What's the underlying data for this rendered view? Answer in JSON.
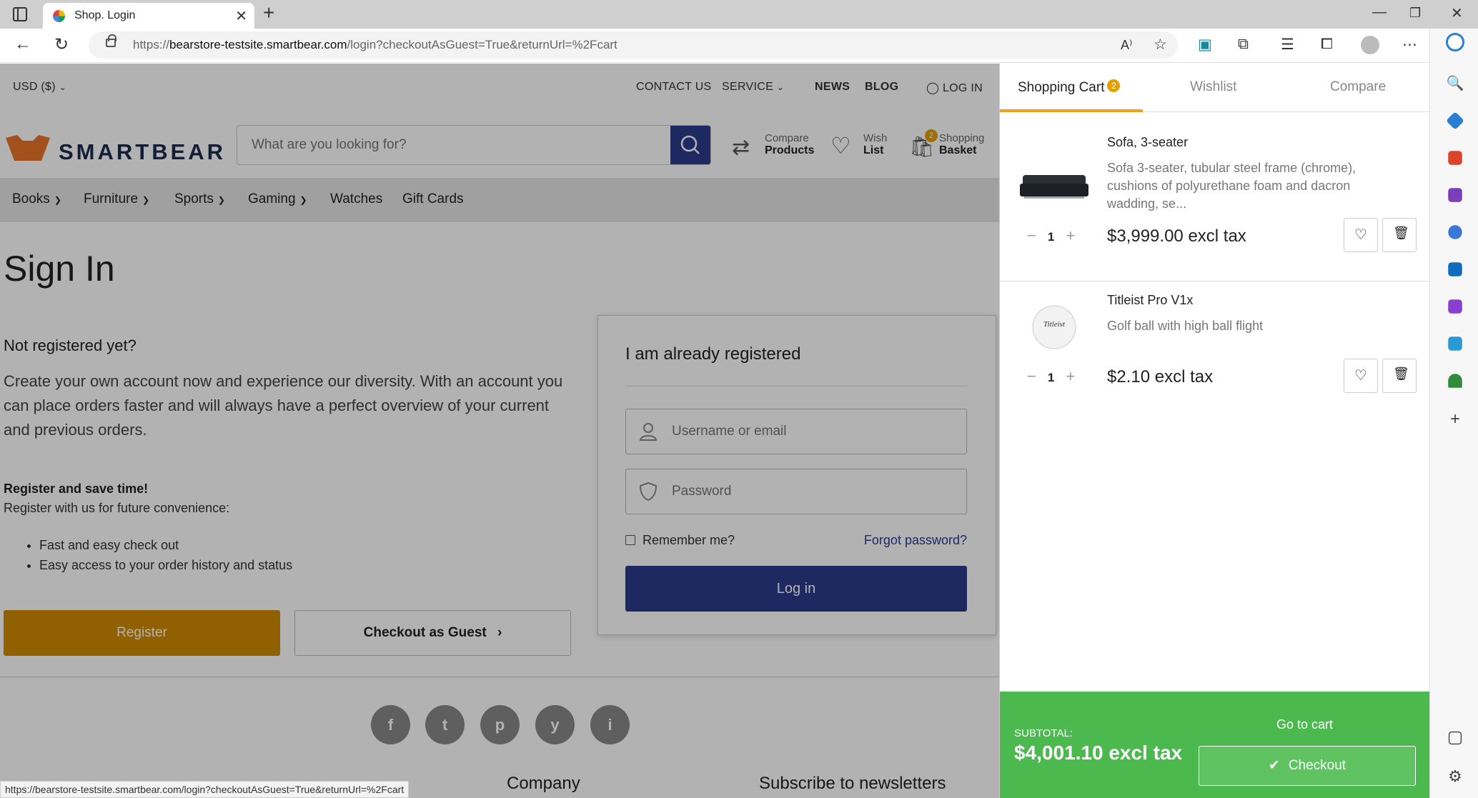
{
  "browser": {
    "tab_title": "Shop. Login",
    "url_prefix": "https://",
    "url_host": "bearstore-testsite.smartbear.com",
    "url_path": "/login?checkoutAsGuest=True&returnUrl=%2Fcart",
    "status_url": "https://bearstore-testsite.smartbear.com/login?checkoutAsGuest=True&returnUrl=%2Fcart"
  },
  "topbar": {
    "currency": "USD  ($)",
    "contact": "CONTACT US",
    "service": "SERVICE",
    "news": "NEWS",
    "blog": "BLOG",
    "login": "LOG IN"
  },
  "header": {
    "logo_text": "SMARTBEAR",
    "search_placeholder": "What are you looking for?",
    "compare_top": "Compare",
    "compare_bottom": "Products",
    "wish_top": "Wish",
    "wish_bottom": "List",
    "basket_top": "Shopping",
    "basket_bottom": "Basket",
    "basket_count": "2"
  },
  "categories": [
    "Books",
    "Furniture",
    "Sports",
    "Gaming",
    "Watches",
    "Gift Cards"
  ],
  "signin": {
    "title": "Sign In",
    "not_registered": "Not registered yet?",
    "create_text": "Create your own account now and experience our diversity. With an account you can place orders faster and will always have a perfect overview of your current and previous orders.",
    "register_save": "Register and save time!",
    "register_convenience": "Register with us for future convenience:",
    "benefits": [
      "Fast and easy check out",
      "Easy access to your order history and status"
    ],
    "register_button": "Register",
    "guest_button": "Checkout as Guest"
  },
  "login_card": {
    "heading": "I am already registered",
    "username_placeholder": "Username or email",
    "password_placeholder": "Password",
    "remember": "Remember me?",
    "forgot": "Forgot password?",
    "login_button": "Log in"
  },
  "footer": {
    "social": [
      "f",
      "t",
      "p",
      "y",
      "i"
    ],
    "company": "Company",
    "newsletter": "Subscribe to newsletters"
  },
  "cart": {
    "tab_cart": "Shopping Cart",
    "tab_cart_badge": "2",
    "tab_wishlist": "Wishlist",
    "tab_compare": "Compare",
    "items": [
      {
        "name": "Sofa, 3-seater",
        "desc": "Sofa 3-seater, tubular steel frame (chrome), cushions of polyurethane foam and dacron wadding, se...",
        "qty": "1",
        "price": "$3,999.00 excl tax"
      },
      {
        "name": "Titleist Pro V1x",
        "desc": "Golf ball with high ball flight",
        "qty": "1",
        "price": "$2.10 excl tax"
      }
    ],
    "subtotal_label": "SUBTOTAL:",
    "subtotal_value": "$4,001.10 excl tax",
    "goto_cart": "Go to cart",
    "checkout": "Checkout"
  },
  "colors": {
    "brand_orange": "#d08a00",
    "brand_navy": "#2c3a8c",
    "cart_green": "#4cb94f",
    "badge_orange": "#e0a000"
  }
}
